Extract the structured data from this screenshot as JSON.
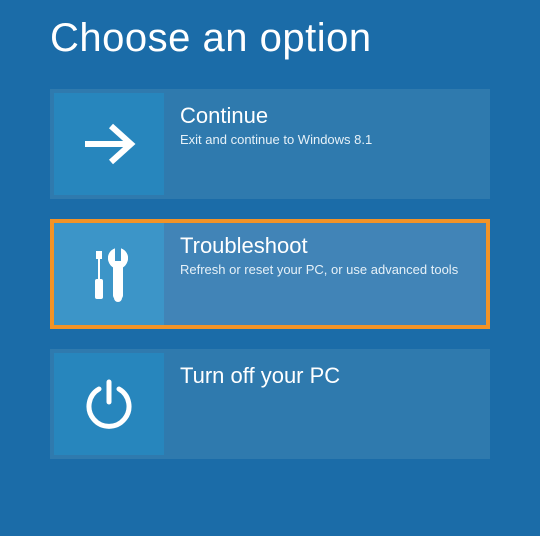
{
  "header": {
    "title": "Choose an option"
  },
  "options": {
    "0": {
      "title": "Continue",
      "desc": "Exit and continue to Windows 8.1",
      "icon": "arrow-right-icon"
    },
    "1": {
      "title": "Troubleshoot",
      "desc": "Refresh or reset your PC, or use advanced tools",
      "icon": "tools-icon"
    },
    "2": {
      "title": "Turn off your PC",
      "desc": "",
      "icon": "power-icon"
    }
  }
}
